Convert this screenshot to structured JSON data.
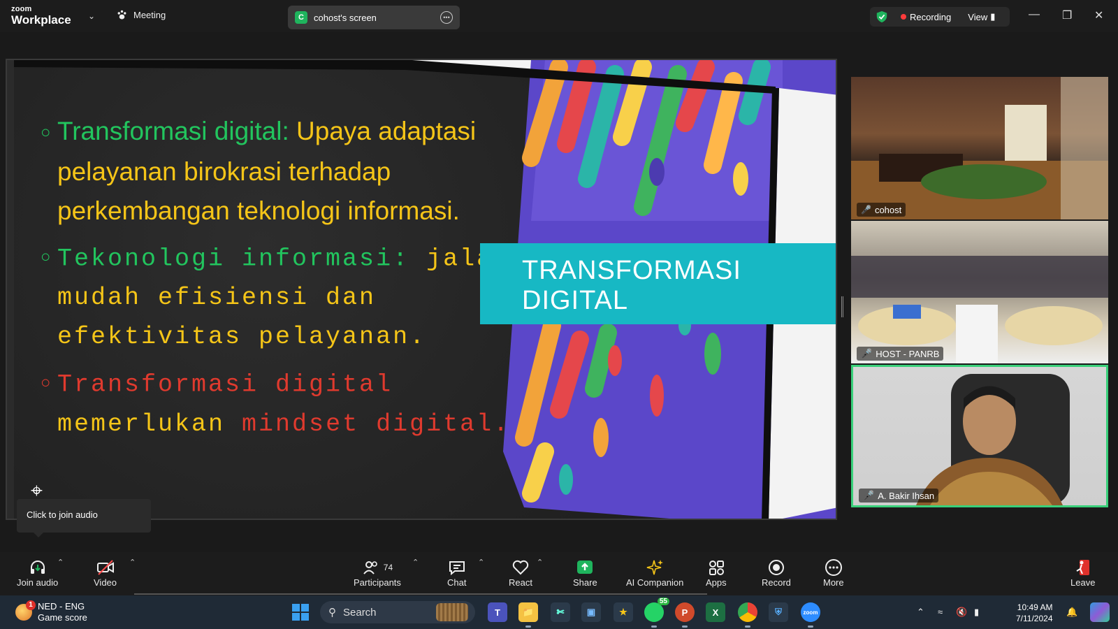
{
  "topbar": {
    "logo_line1": "zoom",
    "logo_line2": "Workplace",
    "meeting_label": "Meeting",
    "screen_share_initial": "C",
    "screen_share_label": "cohost's screen",
    "recording_label": "Recording",
    "view_label": "View"
  },
  "slide": {
    "bullet1_term": "Transformasi digital:",
    "bullet1_line1": " Upaya adaptasi",
    "bullet1_line2": "pelayanan birokrasi terhadap",
    "bullet1_line3": "perkembangan teknologi informasi.",
    "bullet2_term": "Tekonologi informasi:",
    "bullet2_rest": " jala",
    "bullet2_line2": "mudah efisiensi dan",
    "bullet2_line3": "efektivitas pelayanan.",
    "bullet3_line1": "Transformasi digital",
    "bullet3_line2_a": "memerlukan ",
    "bullet3_line2_b": "mindset digital.",
    "banner_title": "TRANSFORMASI DIGITAL"
  },
  "tooltip": {
    "join_audio": "Click to join audio"
  },
  "participants": [
    {
      "name": "cohost"
    },
    {
      "name": "HOST - PANRB"
    },
    {
      "name": "A. Bakir Ihsan"
    }
  ],
  "toolbar": {
    "join_audio": "Join audio",
    "video": "Video",
    "participants": "Participants",
    "participants_count": "74",
    "chat": "Chat",
    "react": "React",
    "share": "Share",
    "ai_companion": "AI Companion",
    "apps": "Apps",
    "record": "Record",
    "more": "More",
    "leave": "Leave"
  },
  "taskbar": {
    "weather_badge": "1",
    "weather_line1": "NED - ENG",
    "weather_line2": "Game score",
    "search_label": "Search",
    "whatsapp_badge": "55",
    "time": "10:49 AM",
    "date": "7/11/2024"
  },
  "colors": {
    "accent_green": "#22c55e",
    "slide_yellow": "#f5c518",
    "slide_red": "#e03a2e",
    "banner_teal": "#17b8c4",
    "active_speaker_border": "#39d07a",
    "recording_red": "#ff3b3b"
  }
}
